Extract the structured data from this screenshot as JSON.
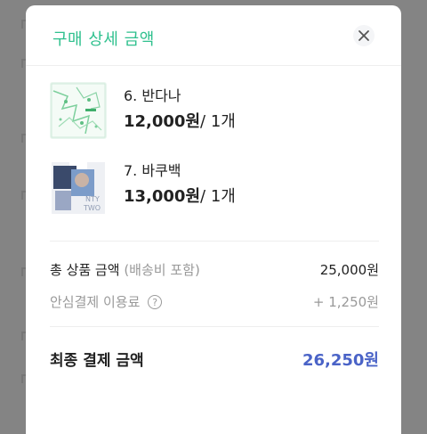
{
  "modal": {
    "title": "구매 상세 금액",
    "close_icon": "close-icon"
  },
  "items": [
    {
      "name": "6. 반다나",
      "price": "12,000원",
      "quantity": "/ 1개",
      "thumbnail": "bandana-thumbnail"
    },
    {
      "name": "7. 바쿠백",
      "price": "13,000원",
      "quantity": "/ 1개",
      "thumbnail": "bag-thumbnail"
    }
  ],
  "summary": {
    "subtotal_label": "총 상품 금액",
    "subtotal_note": "(배송비 포함)",
    "subtotal_value": "25,000원",
    "fee_label": "안심결제 이용료",
    "fee_help_icon": "question-circle-icon",
    "fee_help_glyph": "?",
    "fee_value": "+ 1,250원",
    "total_label": "최종 결제 금액",
    "total_value": "26,250원"
  },
  "colors": {
    "title": "#2fc08e",
    "total": "#4a63c7",
    "muted": "#9a9a9a",
    "overlay": "#848484"
  }
}
